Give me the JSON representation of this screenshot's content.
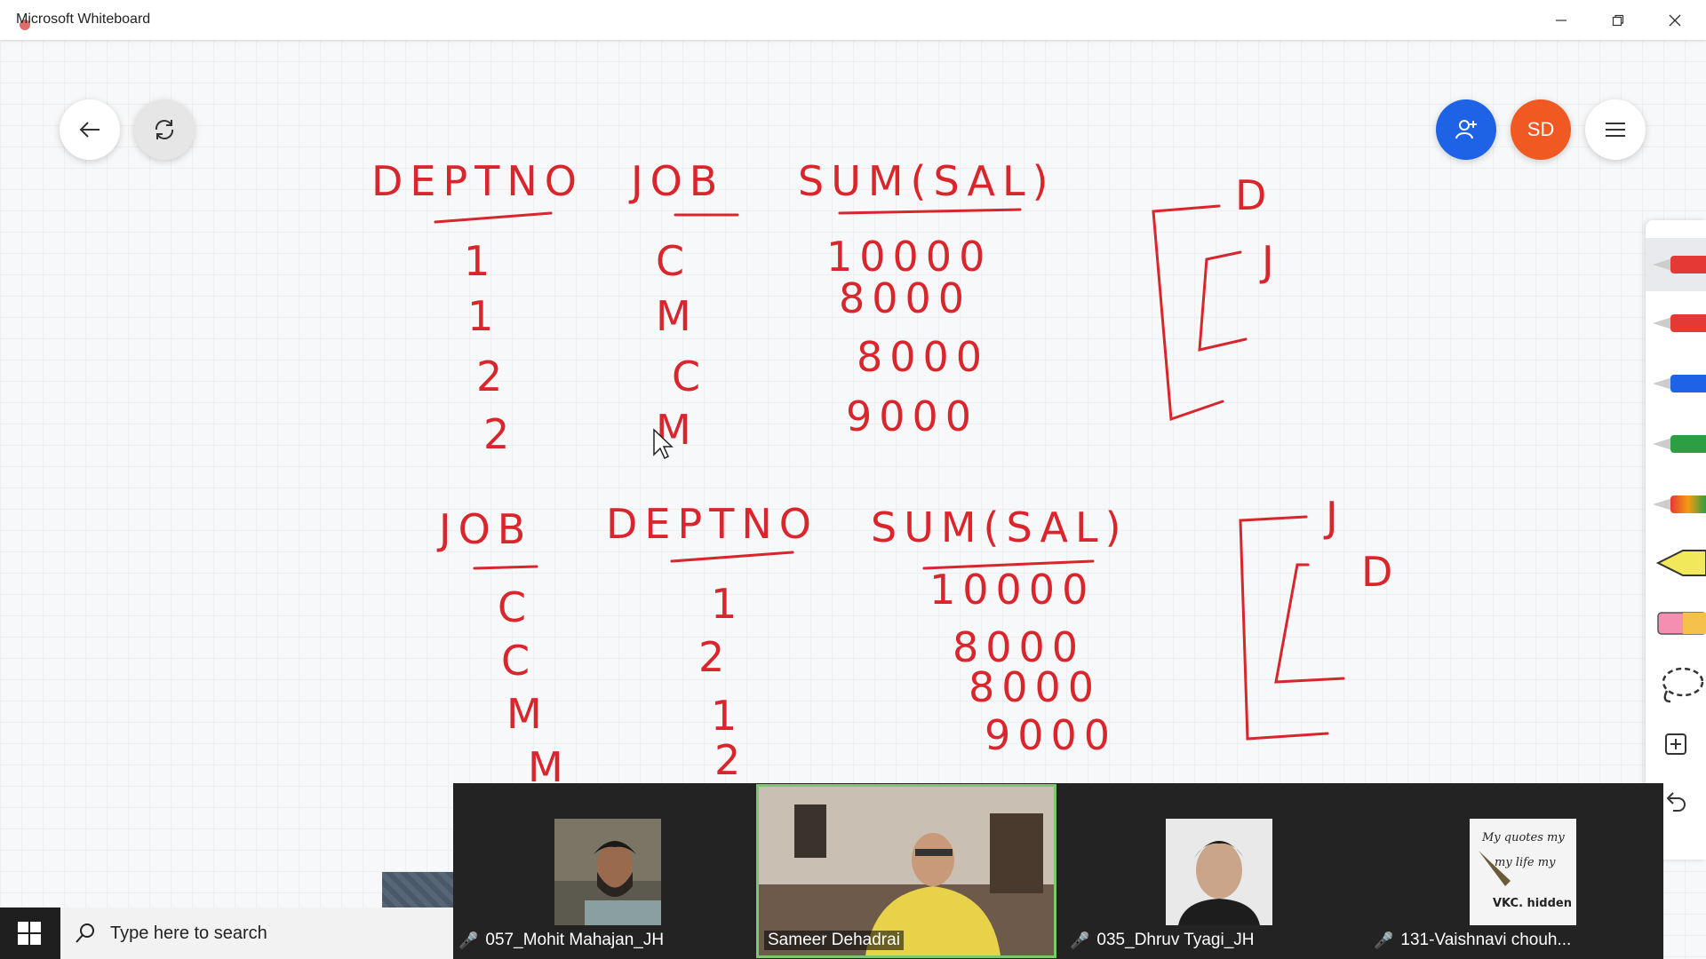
{
  "window": {
    "title": "Microsoft Whiteboard",
    "controls": {
      "minimize_icon": "minimize-icon",
      "restore_icon": "restore-icon",
      "close_icon": "close-icon"
    }
  },
  "canvas_top_left": {
    "back_icon": "arrow-left-icon",
    "sync_icon": "sync-icon"
  },
  "canvas_top_right": {
    "invite_icon": "add-person-icon",
    "avatar_initials": "SD",
    "avatar_color": "#f05a22",
    "invite_color": "#1e63e6",
    "menu_icon": "hamburger-menu-icon"
  },
  "ink": {
    "table1": {
      "headers": [
        "DEPTNO",
        "JOB",
        "SUM(SAL)"
      ],
      "rows": [
        [
          "1",
          "C",
          "10000"
        ],
        [
          "1",
          "M",
          "8000"
        ],
        [
          "2",
          "C",
          "8000"
        ],
        [
          "2",
          "M",
          "9000"
        ]
      ],
      "bracket_labels": [
        "D",
        "J"
      ]
    },
    "table2": {
      "headers": [
        "JOB",
        "DEPTNO",
        "SUM(SAL)"
      ],
      "rows": [
        [
          "C",
          "1",
          "10000"
        ],
        [
          "C",
          "2",
          "8000"
        ],
        [
          "M",
          "1",
          "8000"
        ],
        [
          "M",
          "2",
          "9000"
        ]
      ],
      "bracket_labels": [
        "J",
        "D"
      ]
    },
    "color": "#d8262c"
  },
  "toolbar": {
    "tools": [
      {
        "name": "red-pen",
        "color": "#e53935",
        "selected": true
      },
      {
        "name": "red-pen-2",
        "color": "#e53935"
      },
      {
        "name": "blue-pen",
        "color": "#1e63e6"
      },
      {
        "name": "green-pen",
        "color": "#2e9e44"
      },
      {
        "name": "rainbow-pen",
        "color": "#f39c12"
      },
      {
        "name": "highlighter",
        "color": "#f2e85c"
      },
      {
        "name": "eraser",
        "color": "#f48fb1"
      },
      {
        "name": "lasso",
        "icon": "lasso-icon"
      },
      {
        "name": "add",
        "icon": "plus-square-icon"
      },
      {
        "name": "undo",
        "icon": "undo-icon"
      }
    ]
  },
  "video_strip": {
    "participants": [
      {
        "name": "057_Mohit Mahajan_JH",
        "muted": true
      },
      {
        "name": "Sameer Dehadrai",
        "muted": false,
        "active": true
      },
      {
        "name": "035_Dhruv Tyagi_JH",
        "muted": true
      },
      {
        "name": "131-Vaishnavi chouh...",
        "muted": true
      }
    ],
    "thumb4_text": [
      "My quotes my",
      "my life my",
      "VKC. hidden"
    ]
  },
  "taskbar": {
    "start_icon": "windows-start-icon",
    "search_icon": "search-icon",
    "search_placeholder": "Type here to search"
  }
}
